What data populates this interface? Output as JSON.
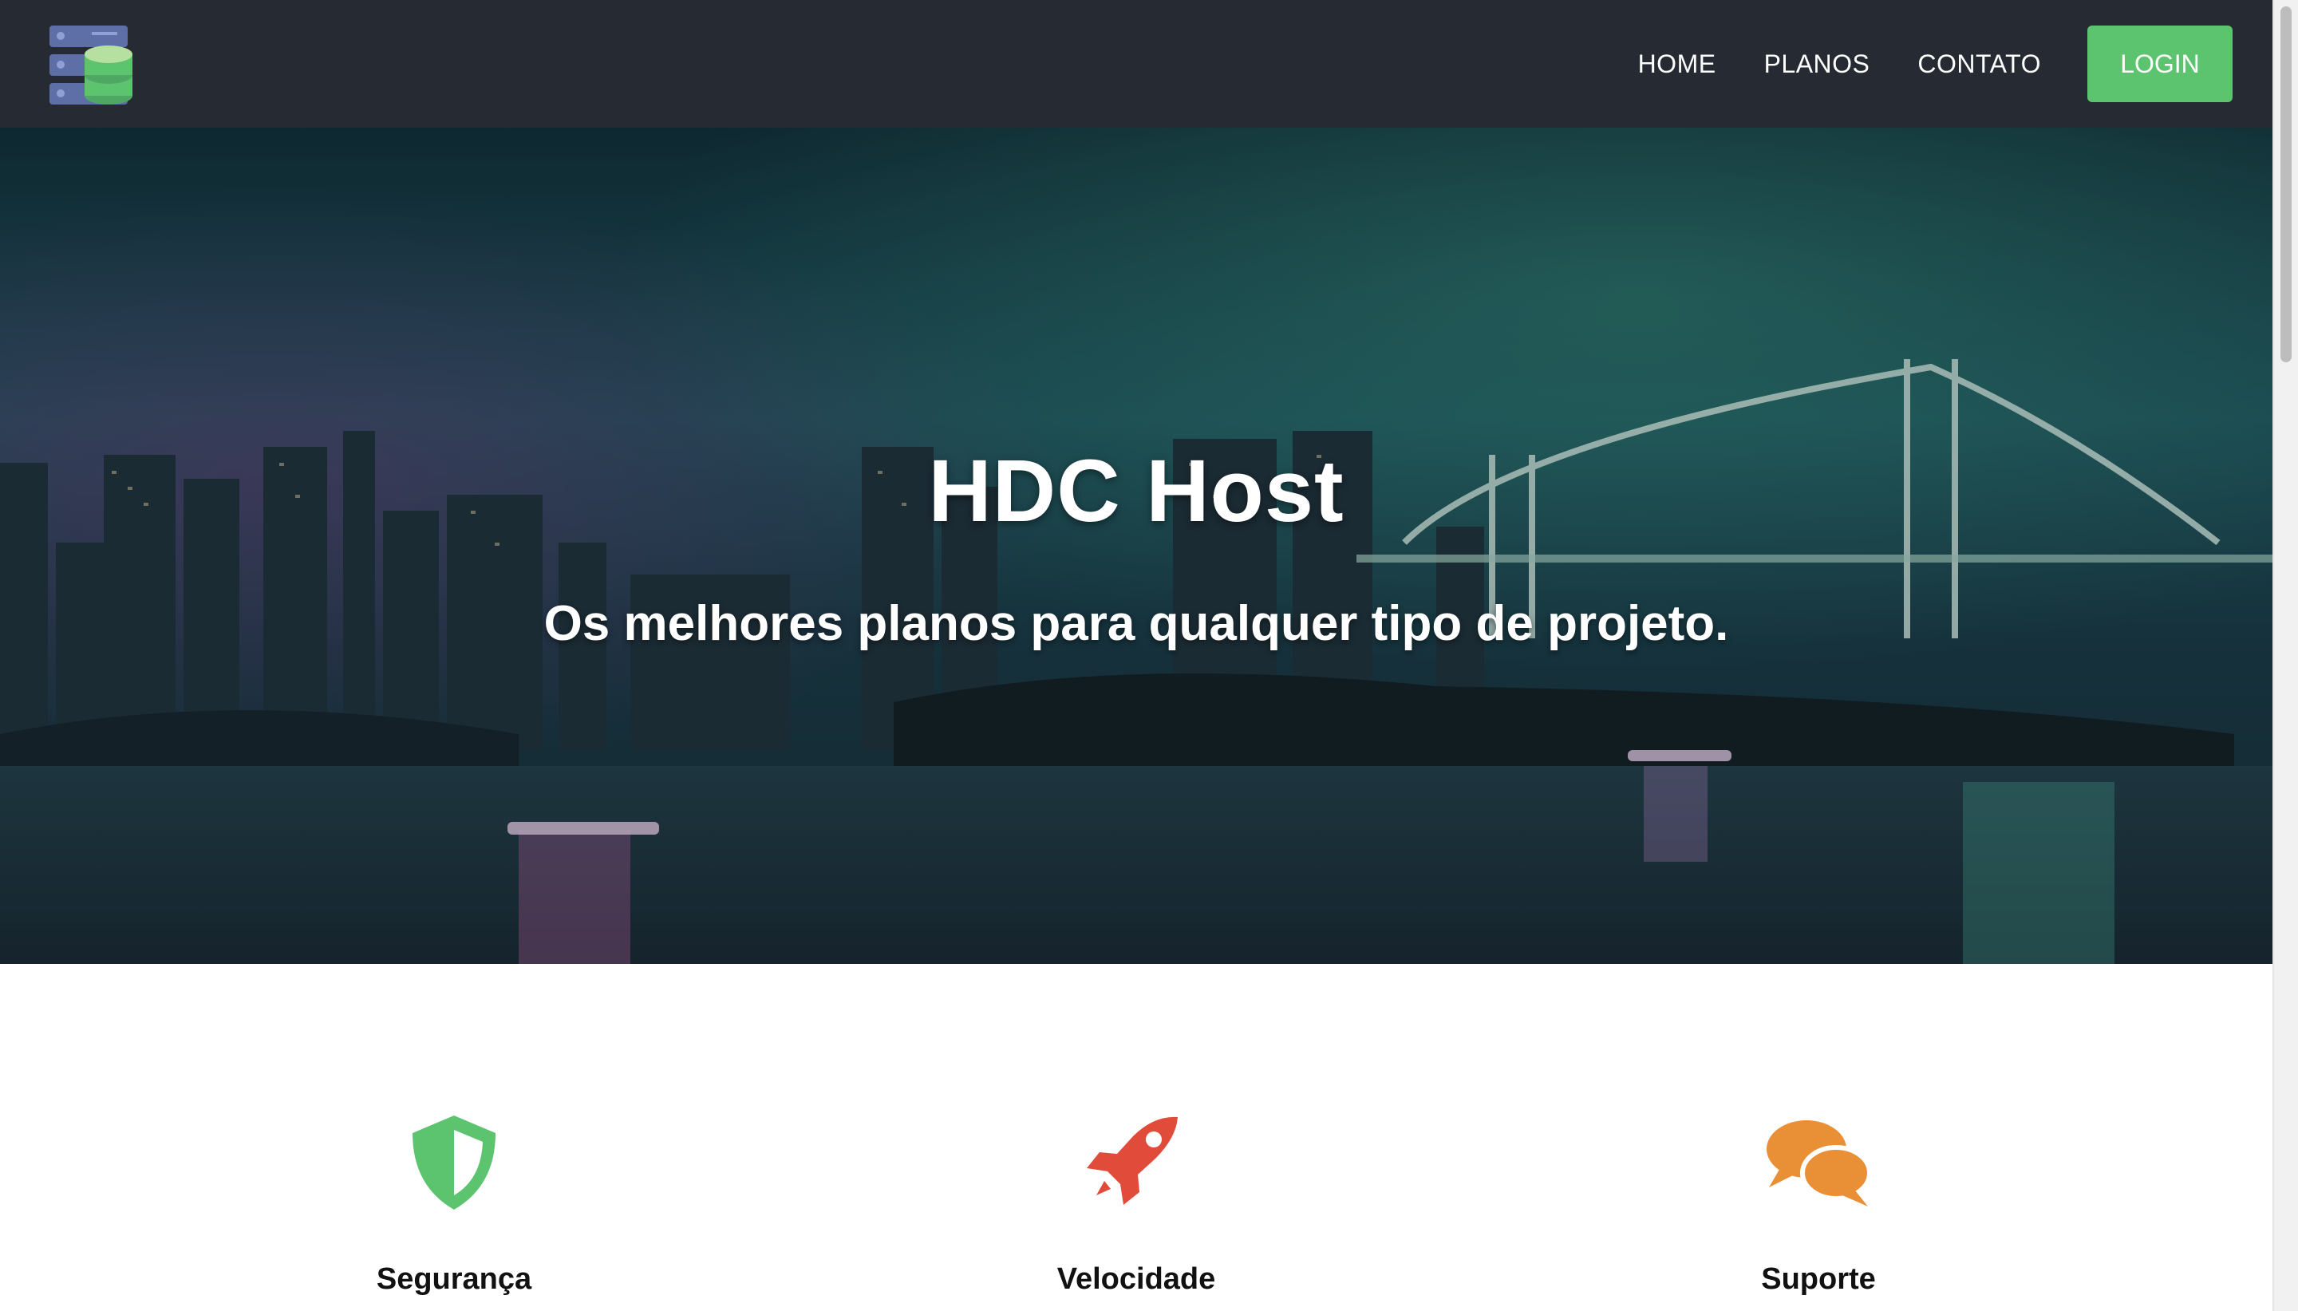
{
  "navbar": {
    "logo_icon": "server-database-icon",
    "links": [
      {
        "label": "HOME"
      },
      {
        "label": "PLANOS"
      },
      {
        "label": "CONTATO"
      }
    ],
    "login_label": "LOGIN"
  },
  "hero": {
    "title": "HDC Host",
    "subtitle": "Os melhores planos para qualquer tipo de projeto."
  },
  "features": [
    {
      "icon": "shield-icon",
      "label": "Segurança",
      "color": "#5cc46e"
    },
    {
      "icon": "rocket-icon",
      "label": "Velocidade",
      "color": "#e04b3a"
    },
    {
      "icon": "chat-bubbles-icon",
      "label": "Suporte",
      "color": "#e98f35"
    }
  ],
  "colors": {
    "navbar_bg": "#262a33",
    "accent_green": "#5cc46e"
  }
}
